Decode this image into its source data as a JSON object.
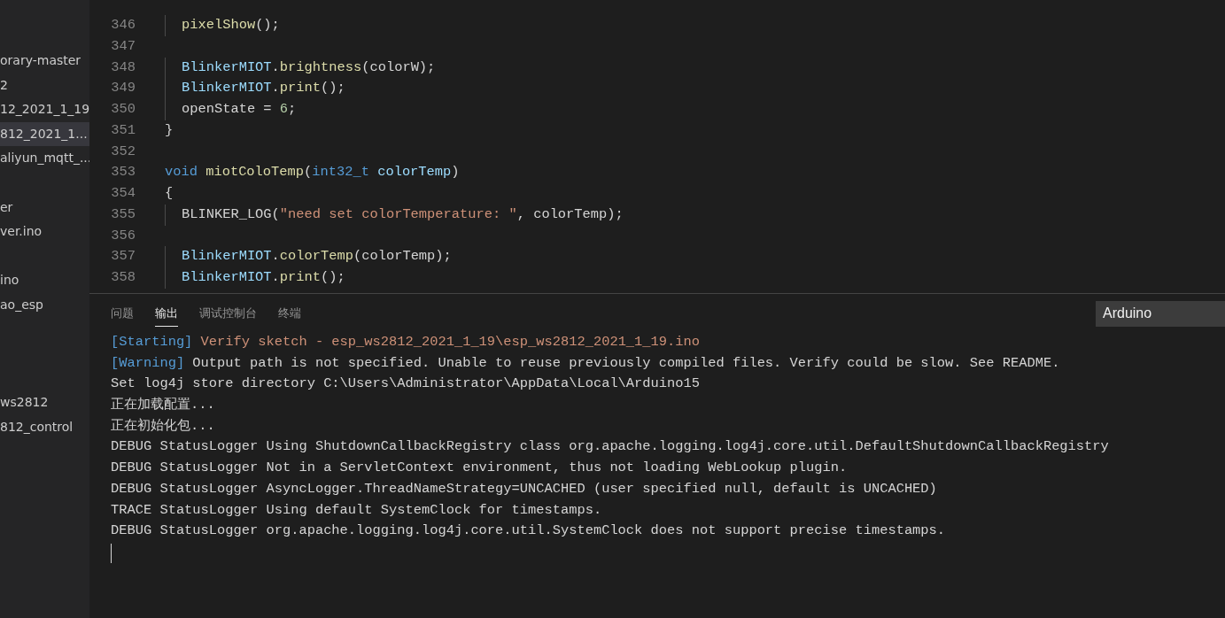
{
  "sidebar": {
    "items": [
      {
        "kind": "file",
        "label": "orary-master",
        "selected": false
      },
      {
        "kind": "file",
        "label": "2",
        "selected": false
      },
      {
        "kind": "file",
        "label": "12_2021_1_19",
        "selected": false
      },
      {
        "kind": "file",
        "label": "812_2021_1...",
        "selected": true
      },
      {
        "kind": "file",
        "label": "aliyun_mqtt_...",
        "selected": false
      },
      {
        "kind": "blank"
      },
      {
        "kind": "file",
        "label": "er",
        "selected": false
      },
      {
        "kind": "file",
        "label": "ver.ino",
        "selected": false
      },
      {
        "kind": "blank"
      },
      {
        "kind": "file",
        "label": "ino",
        "selected": false
      },
      {
        "kind": "file",
        "label": "ao_esp",
        "selected": false
      },
      {
        "kind": "blank"
      },
      {
        "kind": "blank"
      },
      {
        "kind": "blank"
      },
      {
        "kind": "file",
        "label": "ws2812",
        "selected": false
      },
      {
        "kind": "file",
        "label": "812_control",
        "selected": false
      }
    ]
  },
  "editor": {
    "lines": [
      {
        "number": "346",
        "indented": true,
        "tokens": [
          {
            "kind": "function",
            "text": "pixelShow"
          },
          {
            "kind": "plain",
            "text": "();"
          }
        ]
      },
      {
        "number": "347"
      },
      {
        "number": "348",
        "indented": true,
        "tokens": [
          {
            "kind": "variable",
            "text": "BlinkerMIOT"
          },
          {
            "kind": "plain",
            "text": "."
          },
          {
            "kind": "function",
            "text": "brightness"
          },
          {
            "kind": "plain",
            "text": "(colorW);"
          }
        ]
      },
      {
        "number": "349",
        "indented": true,
        "tokens": [
          {
            "kind": "variable",
            "text": "BlinkerMIOT"
          },
          {
            "kind": "plain",
            "text": "."
          },
          {
            "kind": "function",
            "text": "print"
          },
          {
            "kind": "plain",
            "text": "();"
          }
        ]
      },
      {
        "number": "350",
        "indented": true,
        "tokens": [
          {
            "kind": "plain",
            "text": "openState = "
          },
          {
            "kind": "number",
            "text": "6"
          },
          {
            "kind": "plain",
            "text": ";"
          }
        ]
      },
      {
        "number": "351",
        "indented": false,
        "tokens": [
          {
            "kind": "plain",
            "text": "}"
          }
        ]
      },
      {
        "number": "352"
      },
      {
        "number": "353",
        "indented": false,
        "tokens": [
          {
            "kind": "keyword",
            "text": "void"
          },
          {
            "kind": "function",
            "text": " miotColoTemp"
          },
          {
            "kind": "plain",
            "text": "("
          },
          {
            "kind": "keyword",
            "text": "int32_t"
          },
          {
            "kind": "variable",
            "text": " colorTemp"
          },
          {
            "kind": "plain",
            "text": ")"
          }
        ]
      },
      {
        "number": "354",
        "indented": false,
        "tokens": [
          {
            "kind": "plain",
            "text": "{"
          }
        ]
      },
      {
        "number": "355",
        "indented": true,
        "tokens": [
          {
            "kind": "plain",
            "text": "BLINKER_LOG("
          },
          {
            "kind": "string",
            "text": "\"need set colorTemperature: \""
          },
          {
            "kind": "plain",
            "text": ", colorTemp);"
          }
        ]
      },
      {
        "number": "356"
      },
      {
        "number": "357",
        "indented": true,
        "tokens": [
          {
            "kind": "variable",
            "text": "BlinkerMIOT"
          },
          {
            "kind": "plain",
            "text": "."
          },
          {
            "kind": "function",
            "text": "colorTemp"
          },
          {
            "kind": "plain",
            "text": "(colorTemp);"
          }
        ]
      },
      {
        "number": "358",
        "indented": true,
        "tokens": [
          {
            "kind": "variable",
            "text": "BlinkerMIOT"
          },
          {
            "kind": "plain",
            "text": "."
          },
          {
            "kind": "function",
            "text": "print"
          },
          {
            "kind": "plain",
            "text": "();"
          }
        ]
      }
    ]
  },
  "panel": {
    "tabs": [
      {
        "label": "问题",
        "selected": false
      },
      {
        "label": "输出",
        "selected": true
      },
      {
        "label": "调试控制台",
        "selected": false
      },
      {
        "label": "终端",
        "selected": false
      }
    ],
    "channel_select": {
      "value": "Arduino"
    },
    "output": [
      [
        {
          "kind": "tag",
          "text": "[Starting]"
        },
        {
          "kind": "string",
          "text": " Verify sketch - esp_ws2812_2021_1_19\\esp_ws2812_2021_1_19.ino"
        }
      ],
      [
        {
          "kind": "tag",
          "text": "[Warning]"
        },
        {
          "kind": "plain",
          "text": " Output path is not specified. Unable to reuse previously compiled files. Verify could be slow. See README."
        }
      ],
      [
        {
          "kind": "plain",
          "text": "Set log4j store directory C:\\Users\\Administrator\\AppData\\Local\\Arduino15"
        }
      ],
      [
        {
          "kind": "plain",
          "text": "正在加载配置..."
        }
      ],
      [
        {
          "kind": "plain",
          "text": "正在初始化包..."
        }
      ],
      [
        {
          "kind": "plain",
          "text": "DEBUG StatusLogger Using ShutdownCallbackRegistry class org.apache.logging.log4j.core.util.DefaultShutdownCallbackRegistry"
        }
      ],
      [
        {
          "kind": "plain",
          "text": "DEBUG StatusLogger Not in a ServletContext environment, thus not loading WebLookup plugin."
        }
      ],
      [
        {
          "kind": "plain",
          "text": "DEBUG StatusLogger AsyncLogger.ThreadNameStrategy=UNCACHED (user specified null, default is UNCACHED)"
        }
      ],
      [
        {
          "kind": "plain",
          "text": "TRACE StatusLogger Using default SystemClock for timestamps."
        }
      ],
      [
        {
          "kind": "plain",
          "text": "DEBUG StatusLogger org.apache.logging.log4j.core.util.SystemClock does not support precise timestamps."
        }
      ]
    ]
  }
}
